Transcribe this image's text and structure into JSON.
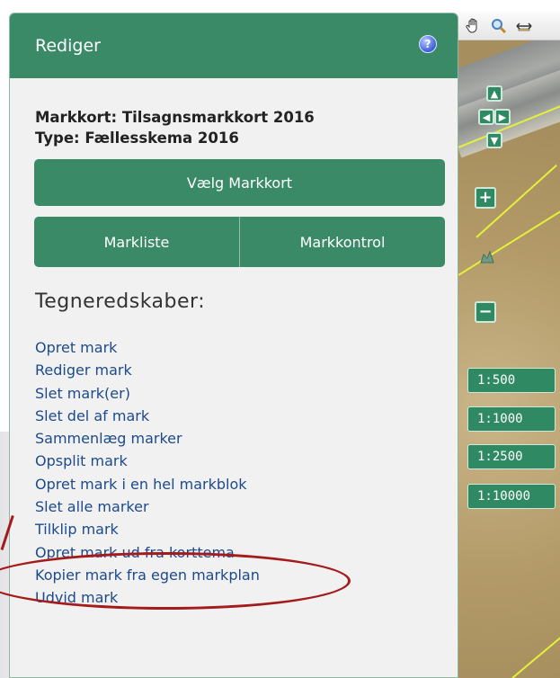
{
  "panel": {
    "title": "Rediger",
    "help_icon": "?",
    "markkort_line": "Markkort: Tilsagnsmarkkort 2016",
    "type_line": "Type: Fællesskema 2016",
    "select_button": "Vælg Markkort",
    "tabs": [
      {
        "label": "Markliste"
      },
      {
        "label": "Markkontrol"
      }
    ],
    "tools_heading": "Tegneredskaber:",
    "tools": [
      "Opret mark",
      "Rediger mark",
      "Slet mark(er)",
      "Slet del af mark",
      "Sammenlæg marker",
      "Opsplit mark",
      "Opret mark i en hel markblok",
      "Slet alle marker",
      "Tilklip mark",
      "Opret mark ud fra korttema",
      "Kopier mark fra egen markplan",
      "Udvid mark"
    ],
    "highlighted_tool": "Opret mark ud fra korttema"
  },
  "map": {
    "toolbar_icons": [
      "pan-hand-icon",
      "zoom-magnifier-icon",
      "measure-icon"
    ],
    "nav_icons": [
      "pan-up-icon",
      "pan-left-icon",
      "pan-right-icon",
      "pan-down-icon"
    ],
    "zoom_in": "+",
    "zoom_out": "−",
    "scales": [
      "1:500",
      "1:1000",
      "1:2500",
      "1:10000"
    ]
  },
  "colors": {
    "panel_green": "#3a8a68",
    "annotation_red": "#a31b1b",
    "link_blue": "#1d4a8c"
  }
}
